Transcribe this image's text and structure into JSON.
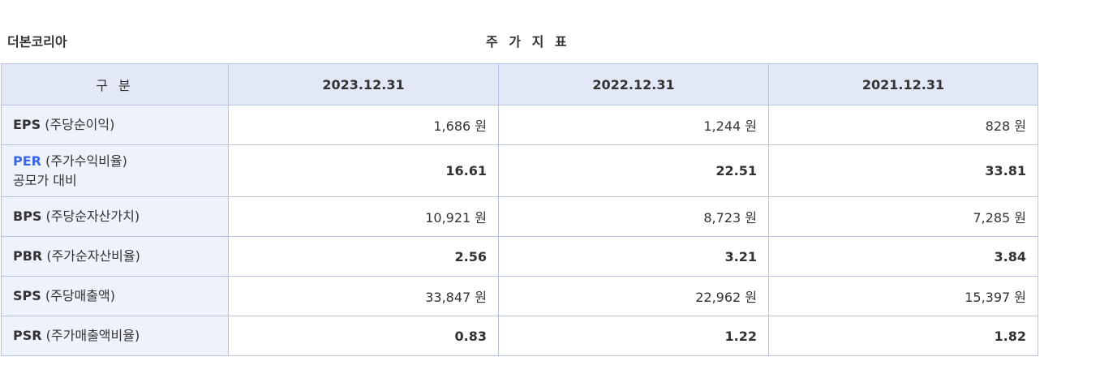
{
  "company": {
    "name": "더본코리아"
  },
  "table": {
    "title": "주 가 지 표",
    "header": {
      "label": "구 분",
      "periods": [
        "2023.12.31",
        "2022.12.31",
        "2021.12.31"
      ]
    },
    "rows": [
      {
        "abbr": "EPS",
        "desc": " (주당순이익)",
        "sub": "",
        "values": [
          "1,686 원",
          "1,244 원",
          "828 원"
        ]
      },
      {
        "abbr": "PER",
        "desc": " (주가수익비율)",
        "sub": "공모가 대비",
        "values": [
          "16.61",
          "22.51",
          "33.81"
        ]
      },
      {
        "abbr": "BPS",
        "desc": " (주당순자산가치)",
        "sub": "",
        "values": [
          "10,921 원",
          "8,723 원",
          "7,285 원"
        ]
      },
      {
        "abbr": "PBR",
        "desc": " (주가순자산비율)",
        "sub": "",
        "values": [
          "2.56",
          "3.21",
          "3.84"
        ]
      },
      {
        "abbr": "SPS",
        "desc": " (주당매출액)",
        "sub": "",
        "values": [
          "33,847 원",
          "22,962 원",
          "15,397 원"
        ]
      },
      {
        "abbr": "PSR",
        "desc": " (주가매출액비율)",
        "sub": "",
        "values": [
          "0.83",
          "1.22",
          "1.82"
        ]
      }
    ]
  },
  "colors": {
    "accent_blue": "#3a66e6",
    "header_bg": "#e2e8f6",
    "label_bg": "#eef2fb",
    "border": "#b7c3e0"
  }
}
